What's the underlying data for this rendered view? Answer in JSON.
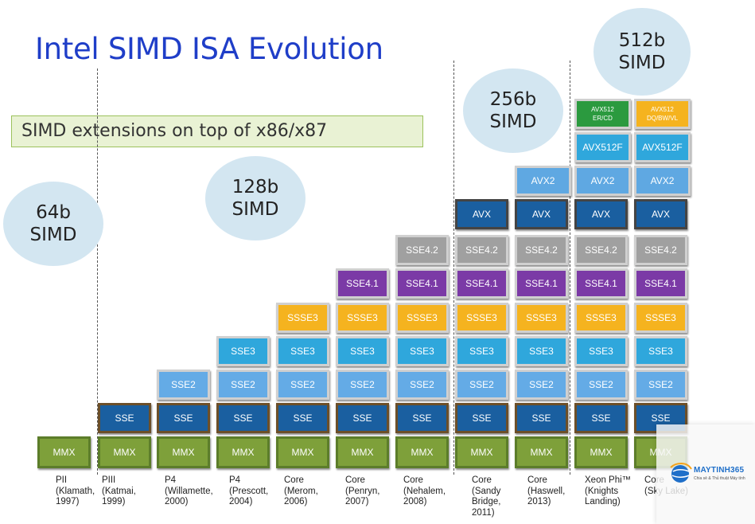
{
  "title": "Intel SIMD ISA Evolution",
  "subtitle": "SIMD extensions on top of x86/x87",
  "bubbles": {
    "b64": {
      "line1": "64b",
      "line2": "SIMD"
    },
    "b128": {
      "line1": "128b",
      "line2": "SIMD"
    },
    "b256": {
      "line1": "256b",
      "line2": "SIMD"
    },
    "b512": {
      "line1": "512b",
      "line2": "SIMD"
    }
  },
  "processors": [
    {
      "label": "PII\n(Klamath,\n1997)"
    },
    {
      "label": "PIII\n(Katmai,\n1999)"
    },
    {
      "label": "P4\n(Willamette,\n2000)"
    },
    {
      "label": "P4\n(Prescott,\n2004)"
    },
    {
      "label": "Core\n(Merom,\n2006)"
    },
    {
      "label": "Core\n(Penryn,\n2007)"
    },
    {
      "label": "Core\n(Nehalem,\n2008)"
    },
    {
      "label": "Core\n(Sandy\nBridge,\n2011)"
    },
    {
      "label": "Core\n(Haswell,\n2013)"
    },
    {
      "label": "Xeon Phi™\n(Knights\nLanding)"
    },
    {
      "label": "Core\n(Sky Lake)"
    }
  ],
  "extensions": [
    {
      "id": "mmx",
      "label": "MMX",
      "cls": "mmx",
      "first_col": 0
    },
    {
      "id": "sse",
      "label": "SSE",
      "cls": "sse",
      "first_col": 1
    },
    {
      "id": "sse2",
      "label": "SSE2",
      "cls": "sse2",
      "first_col": 2
    },
    {
      "id": "sse3",
      "label": "SSE3",
      "cls": "sse3",
      "first_col": 3
    },
    {
      "id": "ssse3",
      "label": "SSSE3",
      "cls": "ssse3",
      "first_col": 4
    },
    {
      "id": "sse41",
      "label": "SSE4.1",
      "cls": "sse41",
      "first_col": 5
    },
    {
      "id": "sse42",
      "label": "SSE4.2",
      "cls": "sse42",
      "first_col": 6
    },
    {
      "id": "avx",
      "label": "AVX",
      "cls": "avx",
      "first_col": 7
    },
    {
      "id": "avx2",
      "label": "AVX2",
      "cls": "avx2",
      "first_col": 8
    },
    {
      "id": "avx512f",
      "label": "AVX512F",
      "cls": "avx512f",
      "first_col": 9
    }
  ],
  "top_extensions": [
    {
      "label": "AVX512\nER/CD",
      "cls": "avx512er",
      "col": 9
    },
    {
      "label": "AVX512\nDQ/BW/VL",
      "cls": "avx512dq",
      "col": 10
    }
  ],
  "logo": {
    "name": "MAYTINH365",
    "tagline": "Chia sẻ & Thủ thuật Máy tính"
  },
  "colors": {
    "title": "#1f3ec8",
    "mmx": "#7ea03a",
    "sse": "#1a5fa0",
    "sse2": "#64abe6",
    "sse3": "#2fa7dc",
    "ssse3": "#f5b31f",
    "sse41": "#7b3aa6",
    "sse42": "#a0a0a0",
    "avx512er": "#2b9a3f"
  }
}
